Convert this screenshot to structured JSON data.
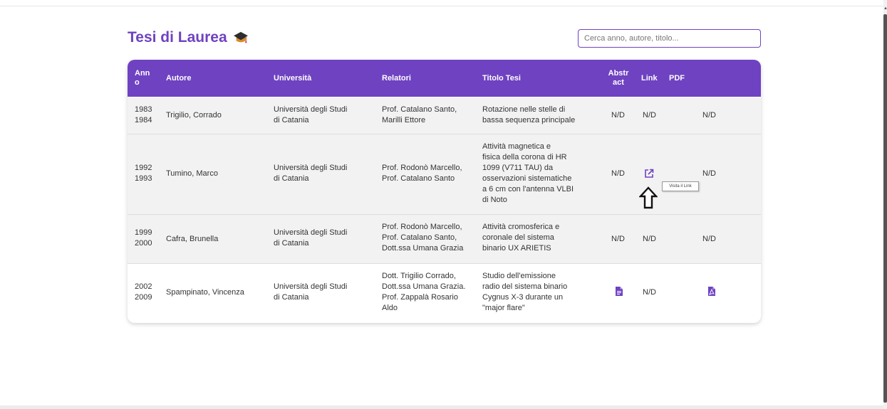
{
  "page": {
    "title": "Tesi di Laurea",
    "search": {
      "placeholder": "Cerca anno, autore, titolo...",
      "value": ""
    }
  },
  "table": {
    "headers": {
      "anno": "Anno",
      "autore": "Autore",
      "universita": "Università",
      "relatori": "Relatori",
      "titolo": "Titolo Tesi",
      "abstract": "Abstract",
      "link": "Link",
      "pdf": "PDF"
    },
    "rows": [
      {
        "anno_start": "1983",
        "anno_end": "1984",
        "autore": "Trigilio, Corrado",
        "universita": [
          "Università degli Studi",
          "di Catania"
        ],
        "relatori": [
          "Prof. Catalano Santo,",
          "Marilli Ettore"
        ],
        "titolo": [
          "Rotazione nelle stelle di",
          "bassa sequenza principale"
        ],
        "abstract": "N/D",
        "link": "N/D",
        "pdf": "N/D"
      },
      {
        "anno_start": "1992",
        "anno_end": "1993",
        "autore": "Tumino, Marco",
        "universita": [
          "Università degli Studi",
          "di Catania"
        ],
        "relatori": [
          "Prof. Rodonò Marcello,",
          "Prof. Catalano Santo"
        ],
        "titolo": [
          "Attività magnetica e",
          "fisica della corona di HR",
          "1099 (V711 TAU) da",
          "osservazioni sistematiche",
          "a 6 cm con l'antenna VLBI",
          "di Noto"
        ],
        "abstract": "N/D",
        "link_icon": "external-link-icon",
        "pdf": "N/D"
      },
      {
        "anno_start": "1999",
        "anno_end": "2000",
        "autore": "Cafra, Brunella",
        "universita": [
          "Università degli Studi",
          "di Catania"
        ],
        "relatori": [
          "Prof. Rodonò Marcello,",
          "Prof. Catalano Santo,",
          "Dott.ssa Umana Grazia"
        ],
        "titolo": [
          "Attività cromosferica e",
          "coronale del sistema",
          "binario UX ARIETIS"
        ],
        "abstract": "N/D",
        "link": "N/D",
        "pdf": "N/D"
      },
      {
        "anno_start": "2002",
        "anno_end": "2009",
        "autore": "Spampinato, Vincenza",
        "universita": [
          "Università degli Studi",
          "di Catania"
        ],
        "relatori": [
          "Dott. Trigilio Corrado,",
          "Dott.ssa Umana Grazia.",
          "Prof. Zappalà Rosario",
          "Aldo"
        ],
        "titolo": [
          "Studio dell'emissione",
          "radio del sistema binario",
          "Cygnus X-3 durante un",
          "\"major flare\""
        ],
        "abstract_icon": "document-icon",
        "link": "N/D",
        "pdf_icon": "pdf-file-icon"
      }
    ]
  },
  "tooltip": {
    "text": "Visita il Link"
  },
  "colors": {
    "accent": "#6f42c1",
    "row_alt": "#f2f2f2"
  }
}
